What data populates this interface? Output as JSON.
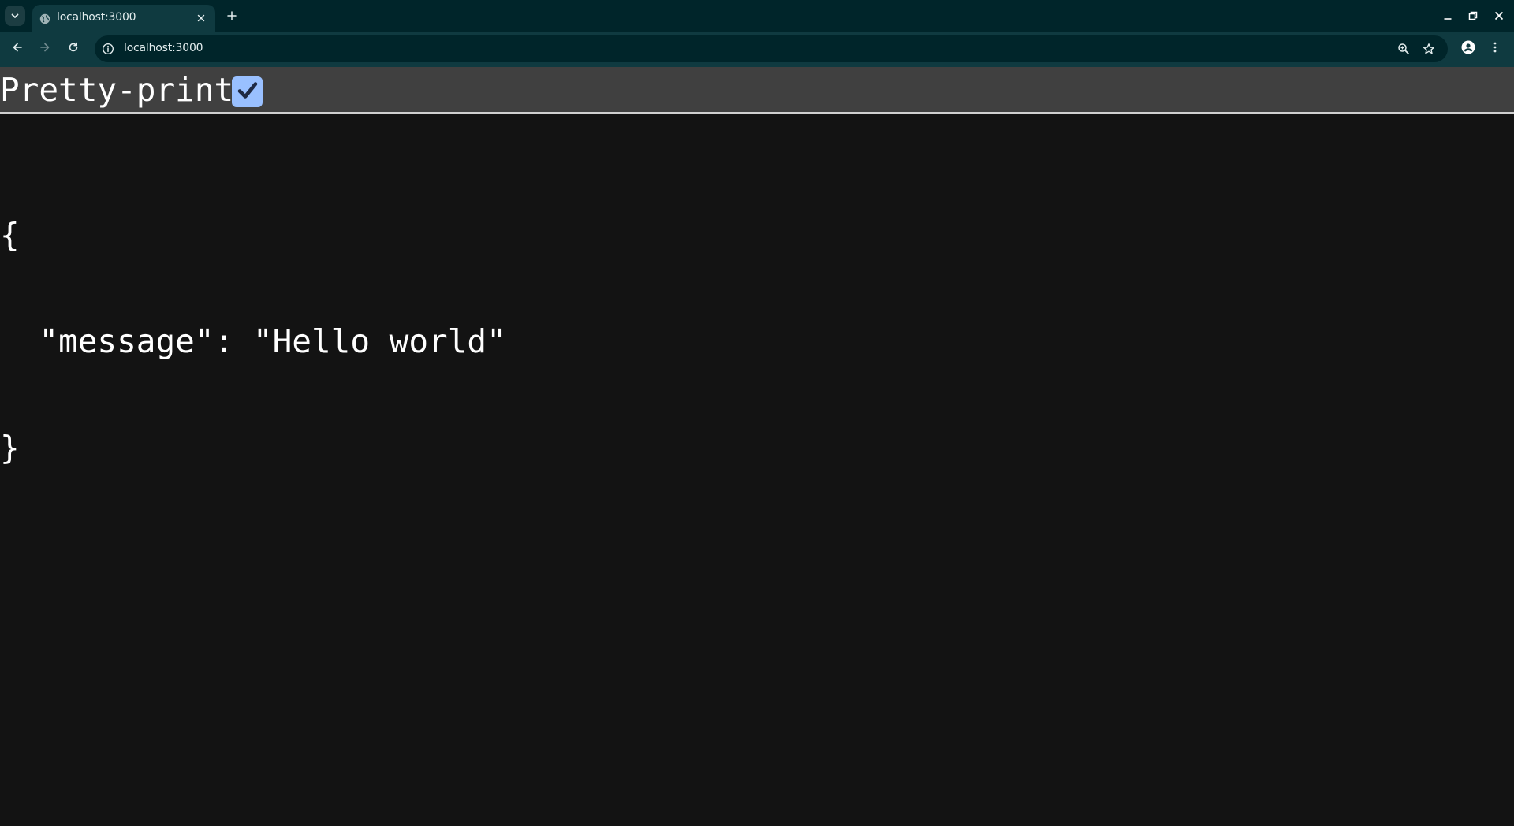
{
  "browser": {
    "tab": {
      "title": "localhost:3000",
      "favicon": "globe-icon"
    },
    "omnibox": {
      "url": "localhost:3000"
    },
    "colors": {
      "tabstrip": "#00252a",
      "toolbar": "#0f3a40",
      "omnibox": "#00252a"
    }
  },
  "page": {
    "pretty_print": {
      "label": "Pretty-print",
      "checked": true
    },
    "json_lines": [
      "{",
      "  \"message\": \"Hello world\"",
      "}"
    ],
    "colors": {
      "header_bg": "#404040",
      "body_bg": "#131313",
      "checkbox": "#99c0ff",
      "text": "#ffffff"
    }
  }
}
